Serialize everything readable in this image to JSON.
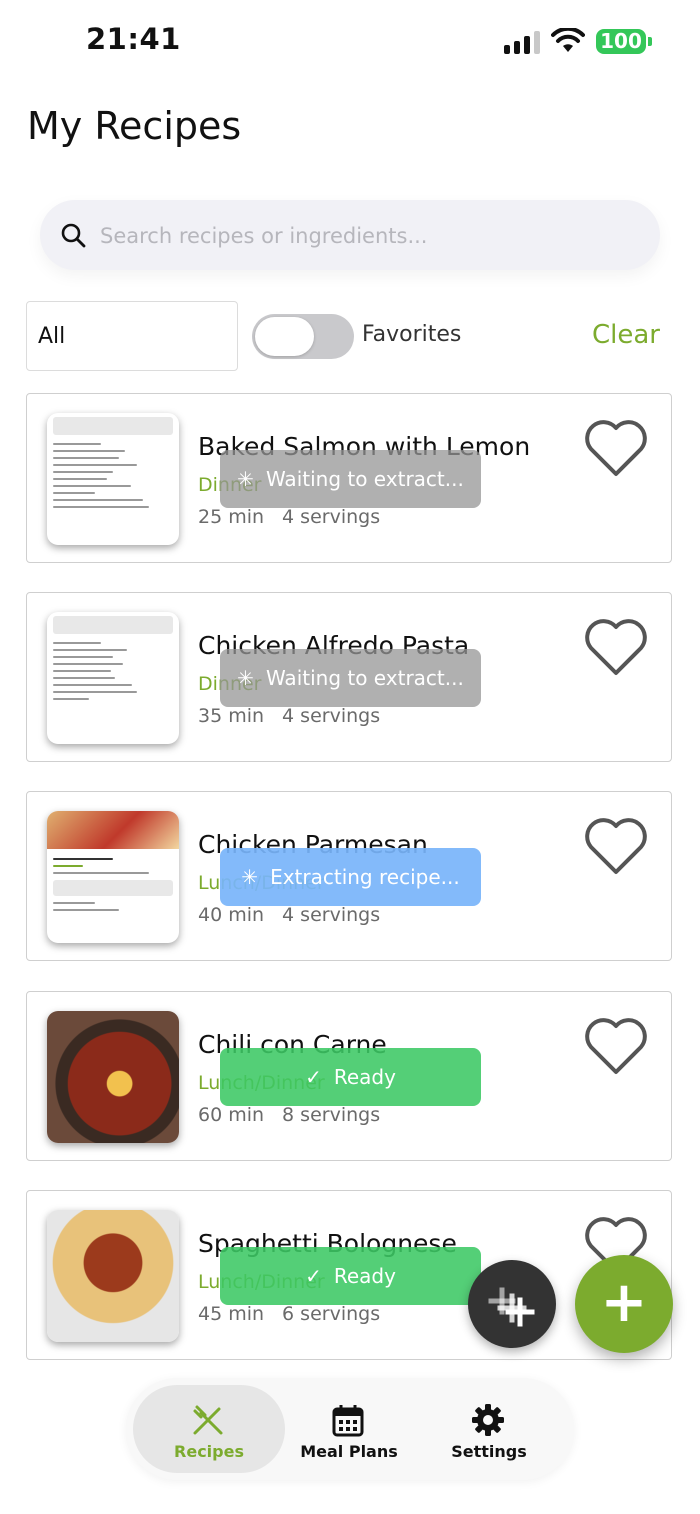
{
  "status_bar": {
    "time": "21:41",
    "battery": "100"
  },
  "header": {
    "title": "My Recipes"
  },
  "search": {
    "placeholder": "Search recipes or ingredients..."
  },
  "filters": {
    "category_value": "All",
    "favorites_label": "Favorites",
    "favorites_on": false,
    "clear_label": "Clear"
  },
  "recipes": [
    {
      "title": "Baked Salmon with Lemon",
      "category": "Dinner",
      "time": "25 min",
      "servings": "4 servings",
      "status": "Waiting to extract...",
      "thumb": "document-photo"
    },
    {
      "title": "Chicken Alfredo Pasta",
      "category": "Dinner",
      "time": "35 min",
      "servings": "4 servings",
      "status": "Waiting to extract...",
      "thumb": "document-photo"
    },
    {
      "title": "Chicken Parmesan",
      "category": "Lunch/Dinner",
      "time": "40 min",
      "servings": "4 servings",
      "status": "Extracting recipe...",
      "thumb": "document-photo"
    },
    {
      "title": "Chili con Carne",
      "category": "Lunch/Dinner",
      "time": "60 min",
      "servings": "8 servings",
      "status": "Ready",
      "thumb": "food-photo"
    },
    {
      "title": "Spaghetti Bolognese",
      "category": "Lunch/Dinner",
      "time": "45 min",
      "servings": "6 servings",
      "status": "Ready",
      "thumb": "food-photo"
    }
  ],
  "tabbar": {
    "items": [
      {
        "label": "Recipes",
        "icon": "utensils-icon",
        "active": true
      },
      {
        "label": "Meal Plans",
        "icon": "calendar-icon",
        "active": false
      },
      {
        "label": "Settings",
        "icon": "gear-icon",
        "active": false
      }
    ]
  },
  "colors": {
    "accent": "#7cab2e",
    "ready": "#3cc864",
    "extracting": "#78b4fa",
    "waiting": "#969696"
  }
}
